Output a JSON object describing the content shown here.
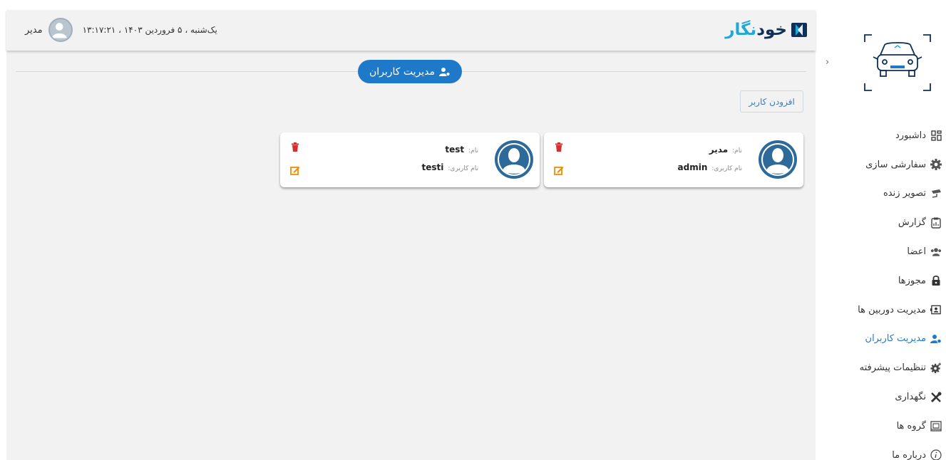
{
  "header": {
    "brand_main": "خود",
    "brand_accent": "نگار",
    "user_name": "مدیر",
    "datetime": "یک‌شنبه ، ۵ فروردین ۱۴۰۳ ، ۱۳:۱۷:۲۱"
  },
  "page": {
    "title": "مدیریت کاربران",
    "add_user_label": "افزودن کاربر"
  },
  "users": [
    {
      "name_label": "نام:",
      "name": "مدیر",
      "username_label": "نام کاربری:",
      "username": "admin"
    },
    {
      "name_label": "نام:",
      "name": "test",
      "username_label": "نام کاربری:",
      "username": "testi"
    }
  ],
  "sidebar": {
    "collapse_glyph": "›",
    "items": [
      {
        "label": "داشبورد",
        "icon": "dashboard-icon"
      },
      {
        "label": "سفارشی سازی",
        "icon": "gear-icon"
      },
      {
        "label": "تصویر زنده",
        "icon": "cctv-camera-icon"
      },
      {
        "label": "گزارش",
        "icon": "report-clipboard-icon"
      },
      {
        "label": "اعضا",
        "icon": "members-icon"
      },
      {
        "label": "مجوزها",
        "icon": "lock-icon"
      },
      {
        "label": "مدیریت دوربین ها",
        "icon": "camera-management-icon"
      },
      {
        "label": "مدیریت کاربران",
        "icon": "user-management-icon",
        "active": true
      },
      {
        "label": "تنظیمات پیشرفته",
        "icon": "advanced-settings-icon"
      },
      {
        "label": "نگهداری",
        "icon": "tools-icon"
      },
      {
        "label": "گروه ها",
        "icon": "groups-icon"
      },
      {
        "label": "درباره ما",
        "icon": "info-icon"
      }
    ]
  },
  "colors": {
    "accent": "#1e7ac9",
    "brand_dark": "#0f3057",
    "brand_light": "#1fa9d8",
    "delete": "#d32f2f",
    "edit": "#f08c00"
  }
}
